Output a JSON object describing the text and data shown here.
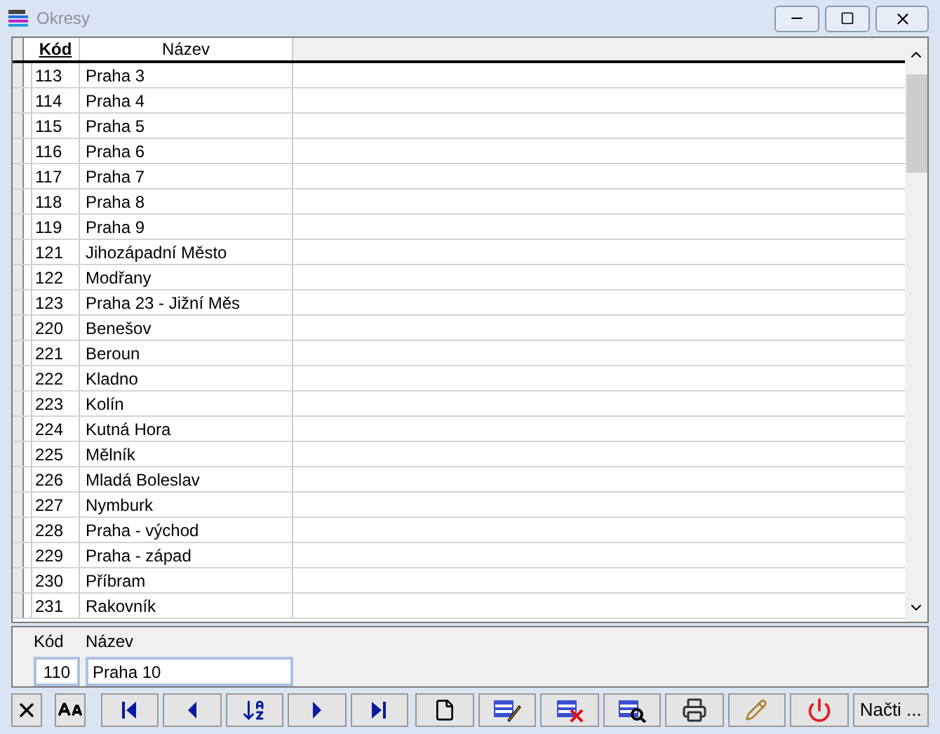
{
  "window": {
    "title": "Okresy"
  },
  "table": {
    "columns": [
      "Kód",
      "Název"
    ],
    "rows": [
      {
        "code": "113",
        "name": "Praha 3"
      },
      {
        "code": "114",
        "name": "Praha 4"
      },
      {
        "code": "115",
        "name": "Praha 5"
      },
      {
        "code": "116",
        "name": "Praha 6"
      },
      {
        "code": "117",
        "name": "Praha 7"
      },
      {
        "code": "118",
        "name": "Praha 8"
      },
      {
        "code": "119",
        "name": "Praha 9"
      },
      {
        "code": "121",
        "name": "Jihozápadní Město"
      },
      {
        "code": "122",
        "name": "Modřany"
      },
      {
        "code": "123",
        "name": "Praha 23 - Jižní Měs"
      },
      {
        "code": "220",
        "name": "Benešov"
      },
      {
        "code": "221",
        "name": "Beroun"
      },
      {
        "code": "222",
        "name": "Kladno"
      },
      {
        "code": "223",
        "name": "Kolín"
      },
      {
        "code": "224",
        "name": "Kutná Hora"
      },
      {
        "code": "225",
        "name": "Mělník"
      },
      {
        "code": "226",
        "name": "Mladá Boleslav"
      },
      {
        "code": "227",
        "name": "Nymburk"
      },
      {
        "code": "228",
        "name": "Praha - východ"
      },
      {
        "code": "229",
        "name": "Praha - západ"
      },
      {
        "code": "230",
        "name": "Příbram"
      },
      {
        "code": "231",
        "name": "Rakovník"
      }
    ]
  },
  "form": {
    "fields": [
      {
        "label": "Kód",
        "value": "110"
      },
      {
        "label": "Název",
        "value": "Praha 10"
      }
    ]
  },
  "toolbar": [
    {
      "kind": "cancel"
    },
    {
      "kind": "font"
    },
    {
      "kind": "first"
    },
    {
      "kind": "prev"
    },
    {
      "kind": "sort"
    },
    {
      "kind": "next"
    },
    {
      "kind": "last"
    },
    {
      "kind": "new"
    },
    {
      "kind": "edit"
    },
    {
      "kind": "delete"
    },
    {
      "kind": "find"
    },
    {
      "kind": "print"
    },
    {
      "kind": "tools"
    },
    {
      "kind": "power"
    }
  ],
  "load_button": {
    "label": "Načti ..."
  }
}
